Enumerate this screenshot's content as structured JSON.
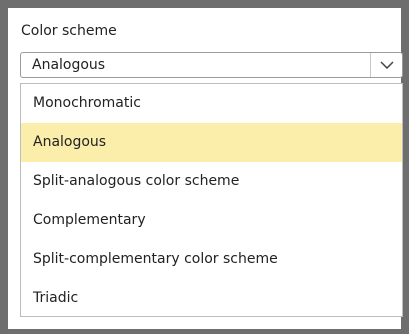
{
  "field": {
    "label": "Color scheme",
    "selected_value": "Analogous"
  },
  "icons": {
    "dropdown_arrow": "chevron-down-icon"
  },
  "colors": {
    "highlight": "#fbeeab",
    "frame": "#6e6e6e"
  },
  "dropdown": {
    "highlighted_index": 1,
    "options": [
      {
        "label": "Monochromatic"
      },
      {
        "label": "Analogous"
      },
      {
        "label": "Split-analogous color scheme"
      },
      {
        "label": "Complementary"
      },
      {
        "label": "Split-complementary color scheme"
      },
      {
        "label": "Triadic"
      }
    ]
  }
}
